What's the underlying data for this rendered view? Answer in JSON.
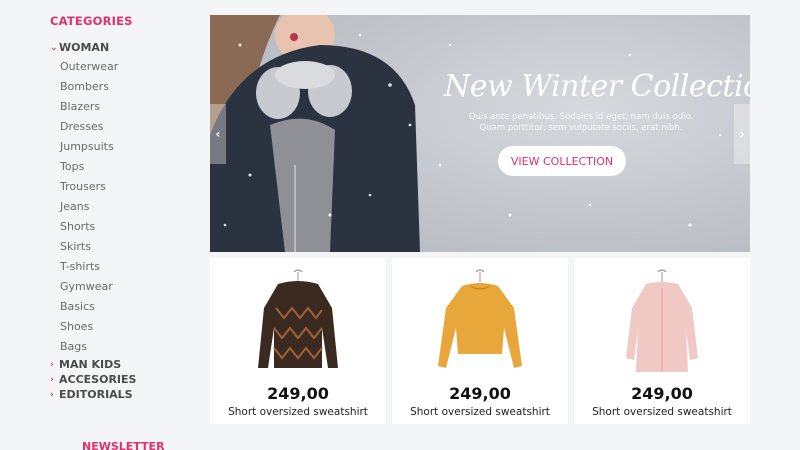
{
  "sidebar": {
    "title": "CATEGORIES",
    "woman": "WOMAN",
    "items": [
      "Outerwear",
      "Bombers",
      "Blazers",
      "Dresses",
      "Jumpsuits",
      "Tops",
      "Trousers",
      "Jeans",
      "Shorts",
      "Skirts",
      "T-shirts",
      "Gymwear",
      "Basics",
      "Shoes",
      "Bags"
    ],
    "groups": [
      "MAN KIDS",
      "ACCESORIES",
      "EDITORIALS"
    ],
    "newsletter": "NEWSLETTER"
  },
  "hero": {
    "title": "New Winter Collection",
    "text": "Quis ante penatibus. Sodales id eget, nam duis odio. Quam porttitor, sem vulputate sociis, erat nibh.",
    "button": "VIEW COLLECTION"
  },
  "products": [
    {
      "price": "249,00",
      "name": "Short oversized sweatshirt",
      "icon": "brown-sweater-image"
    },
    {
      "price": "249,00",
      "name": "Short oversized sweatshirt",
      "icon": "yellow-sweater-image"
    },
    {
      "price": "249,00",
      "name": "Short oversized sweatshirt",
      "icon": "pink-coat-image"
    }
  ],
  "colors": {
    "accent": "#e0306f"
  }
}
